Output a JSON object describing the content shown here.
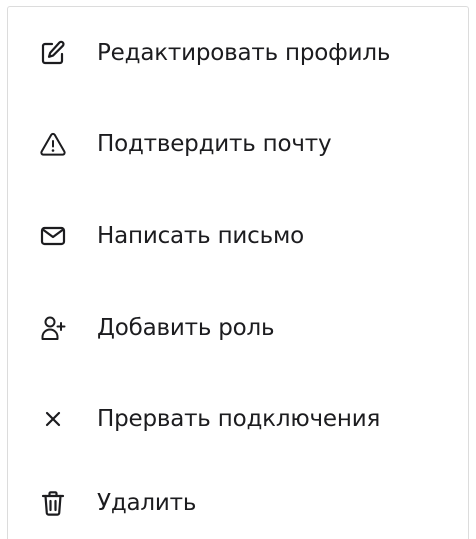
{
  "menu": {
    "items": [
      {
        "label": "Редактировать профиль",
        "icon": "edit-icon"
      },
      {
        "label": "Подтвердить почту",
        "icon": "warning-icon"
      },
      {
        "label": "Написать письмо",
        "icon": "mail-icon"
      },
      {
        "label": "Добавить роль",
        "icon": "add-user-icon"
      },
      {
        "label": "Прервать подключения",
        "icon": "close-icon"
      },
      {
        "label": "Удалить",
        "icon": "trash-icon"
      }
    ]
  },
  "colors": {
    "text": "#1c1c1f",
    "icon": "#1c1c1f",
    "border": "#dcdcdc",
    "background": "#ffffff"
  }
}
